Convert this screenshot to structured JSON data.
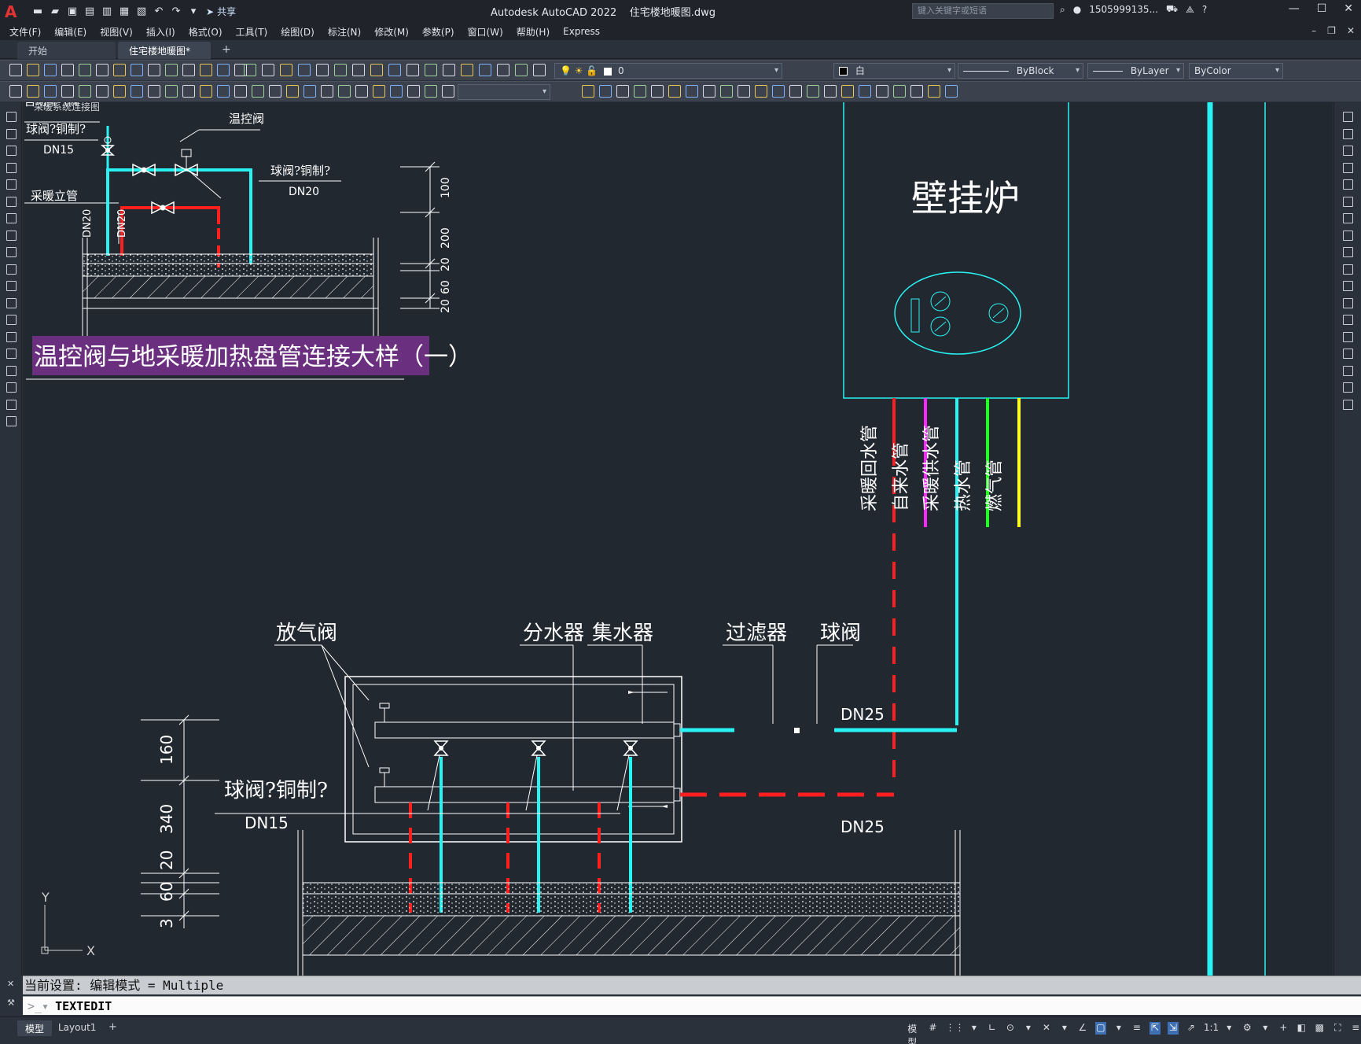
{
  "titlebar": {
    "logo": "A",
    "share": "共享",
    "title": "Autodesk AutoCAD 2022    住宅楼地暖图.dwg",
    "search_placeholder": "键入关键字或短语",
    "user": "1505999135...",
    "help": "?"
  },
  "menu": [
    "文件(F)",
    "编辑(E)",
    "视图(V)",
    "插入(I)",
    "格式(O)",
    "工具(T)",
    "绘图(D)",
    "标注(N)",
    "修改(M)",
    "参数(P)",
    "窗口(W)",
    "帮助(H)",
    "Express"
  ],
  "tabs": {
    "start": "开始",
    "active": "住宅楼地暖图*"
  },
  "toolbar": {
    "layer": "0",
    "color": "白",
    "linetype": "ByBlock",
    "lineweight": "ByLayer",
    "plotstyle": "ByColor"
  },
  "drawing": {
    "top_block_label": "自动排气阀",
    "top_block_sublabel": "采暖系统连接图",
    "ball_valve_copper": "球阀?铜制?",
    "temp_valve": "温控阀",
    "heating_riser": "采暖立管",
    "dn15": "DN15",
    "dn20": "DN20",
    "dn25": "DN25",
    "dims_top": [
      "100",
      "200",
      "20",
      "60",
      "20"
    ],
    "dims_bottom": [
      "160",
      "340",
      "20",
      "60",
      "3"
    ],
    "detail_title": "温控阀与地采暖加热盘管连接大样（一）",
    "boiler": "壁挂炉",
    "pipes": [
      "采暖回水管",
      "自来水管",
      "采暖供水管",
      "热水管",
      "燃气管"
    ],
    "air_valve": "放气阀",
    "distributor": "分水器",
    "collector": "集水器",
    "filter": "过滤器",
    "ball_valve": "球阀",
    "ucs_x": "X",
    "ucs_y": "Y"
  },
  "command": {
    "history": "当前设置: 编辑模式 = Multiple",
    "input": "TEXTEDIT"
  },
  "status": {
    "model": "模型",
    "layout": "Layout1",
    "mode": "模型",
    "scale": "1:1"
  },
  "colors": {
    "cyan": "#29f2f2",
    "red": "#ff1f1f",
    "magenta": "#ff27ff",
    "green": "#22ff22",
    "yellow": "#ffff22",
    "title_bg": "#6b2f7f"
  }
}
